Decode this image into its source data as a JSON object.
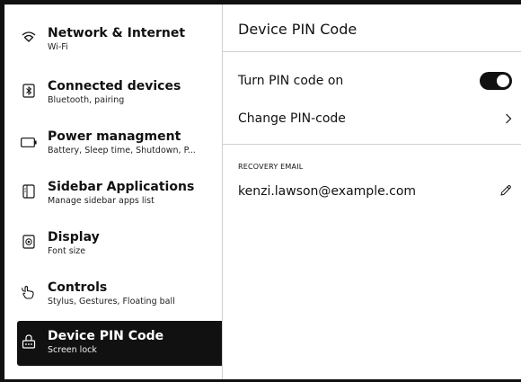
{
  "sidebar": {
    "items": [
      {
        "title": "Network & Internet",
        "subtitle": "Wi-Fi",
        "icon": "wifi-icon"
      },
      {
        "title": "Connected devices",
        "subtitle": "Bluetooth, pairing",
        "icon": "bluetooth-icon"
      },
      {
        "title": "Power managment",
        "subtitle": "Battery, Sleep time, Shutdown, P...",
        "icon": "battery-icon"
      },
      {
        "title": "Sidebar Applications",
        "subtitle": "Manage sidebar apps list",
        "icon": "sidebar-apps-icon"
      },
      {
        "title": "Display",
        "subtitle": "Font size",
        "icon": "display-icon"
      },
      {
        "title": "Controls",
        "subtitle": "Stylus, Gestures, Floating ball",
        "icon": "gesture-hand-icon"
      },
      {
        "title": "Device PIN Code",
        "subtitle": "Screen lock",
        "icon": "lock-icon",
        "active": true
      }
    ]
  },
  "main": {
    "title": "Device PIN Code",
    "pin_toggle": {
      "label": "Turn PIN code on",
      "state": "on"
    },
    "change_pin": {
      "label": "Change PIN-code"
    },
    "recovery": {
      "section_label": "RECOVERY EMAIL",
      "email": "kenzi.lawson@example.com"
    }
  },
  "colors": {
    "accent": "#111111",
    "divider": "#cfcfcf",
    "background": "#ffffff"
  }
}
